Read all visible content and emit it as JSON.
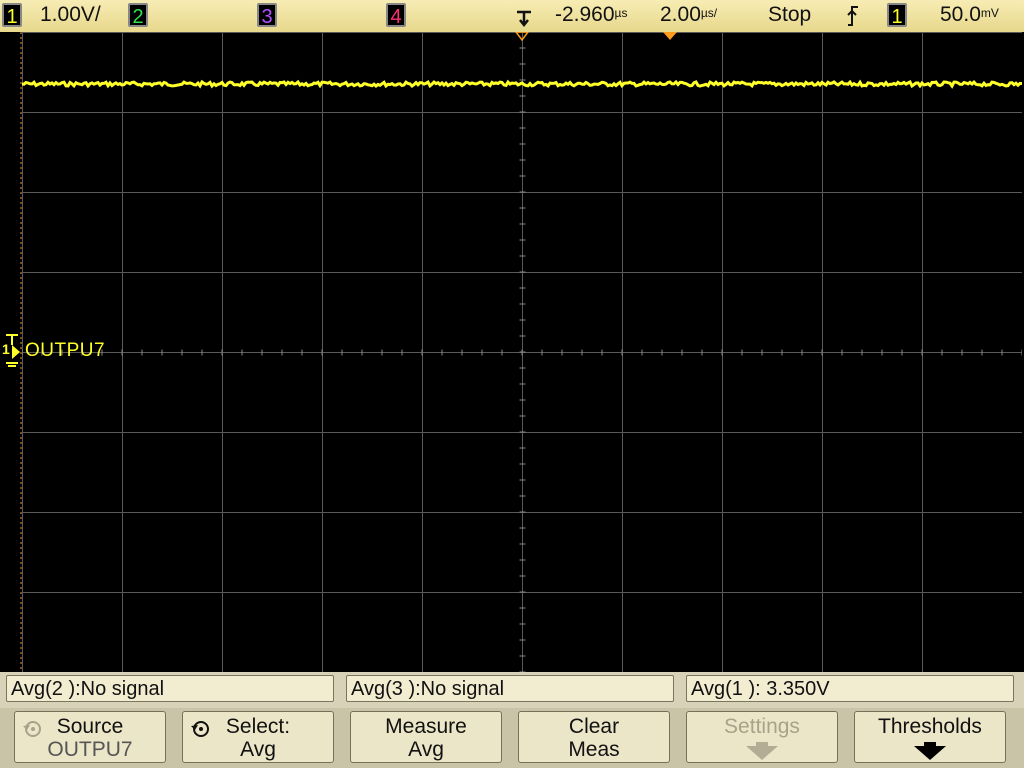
{
  "status": {
    "ch1_badge": "1",
    "ch1_scale": "1.00V/",
    "ch2_badge": "2",
    "ch3_badge": "3",
    "ch4_badge": "4",
    "delay_value": "-2.960",
    "delay_unit": "us",
    "timebase_value": "2.00",
    "timebase_unit": "us/",
    "run_state": "Stop",
    "trigger_slope": "rising",
    "trigger_source_badge": "1",
    "trigger_level_value": "50.0",
    "trigger_level_unit": "mV"
  },
  "colors": {
    "ch1": "#ffff2a",
    "ch2": "#33e04a",
    "ch3": "#b050ff",
    "ch4": "#ff3070",
    "grid": "#5a5a5a",
    "trigger_marker": "#ff9a1a"
  },
  "screen": {
    "channel_label": "OUTPU7",
    "ground_marker_label": "1"
  },
  "measurements": [
    {
      "label": "Avg(2 ):No signal"
    },
    {
      "label": "Avg(3 ):No signal"
    },
    {
      "label": "Avg(1 ): 3.350V"
    }
  ],
  "softkeys": [
    {
      "line1": "Source",
      "line2": "OUTPU7",
      "icon": "rotate-knob-icon",
      "enabled": true
    },
    {
      "line1": "Select:",
      "line2": "Avg",
      "icon": "rotate-knob-icon",
      "enabled": true
    },
    {
      "line1": "Measure",
      "line2": "Avg",
      "enabled": true
    },
    {
      "line1": "Clear",
      "line2": "Meas",
      "enabled": true
    },
    {
      "line1": "Settings",
      "icon": "arrow-down-icon",
      "enabled": false
    },
    {
      "line1": "Thresholds",
      "icon": "arrow-down-icon",
      "enabled": true
    }
  ]
}
